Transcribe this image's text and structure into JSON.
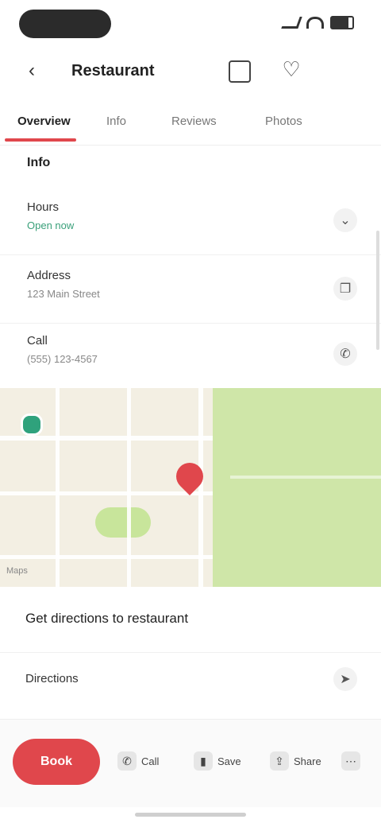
{
  "status_bar": {
    "time": ""
  },
  "header": {
    "title": "Restaurant"
  },
  "tabs": [
    {
      "label": "Overview"
    },
    {
      "label": "Info"
    },
    {
      "label": "Reviews"
    },
    {
      "label": "Photos"
    }
  ],
  "section": {
    "title": "Info"
  },
  "rows": [
    {
      "title": "Hours",
      "subtitle": "Open now"
    },
    {
      "title": "Address",
      "subtitle": "123 Main Street"
    },
    {
      "title": "Call",
      "subtitle": "(555) 123-4567"
    }
  ],
  "map": {
    "credit": "Maps"
  },
  "directions": {
    "link_text": "Get directions to restaurant",
    "label": "Directions"
  },
  "bottom_bar": {
    "book_label": "Book",
    "actions": [
      {
        "label": "Call"
      },
      {
        "label": "Save"
      },
      {
        "label": "Share"
      },
      {
        "label": "More"
      }
    ]
  },
  "colors": {
    "accent": "#e0474c",
    "open_green": "#3aa07a",
    "park_green": "#cfe6a8"
  },
  "icons": {
    "back": "back-arrow-icon",
    "share": "share-icon",
    "favorite": "heart-icon",
    "chevron": "chevron-right-icon",
    "copy": "copy-icon",
    "phone": "phone-icon",
    "navigate": "navigate-icon"
  }
}
